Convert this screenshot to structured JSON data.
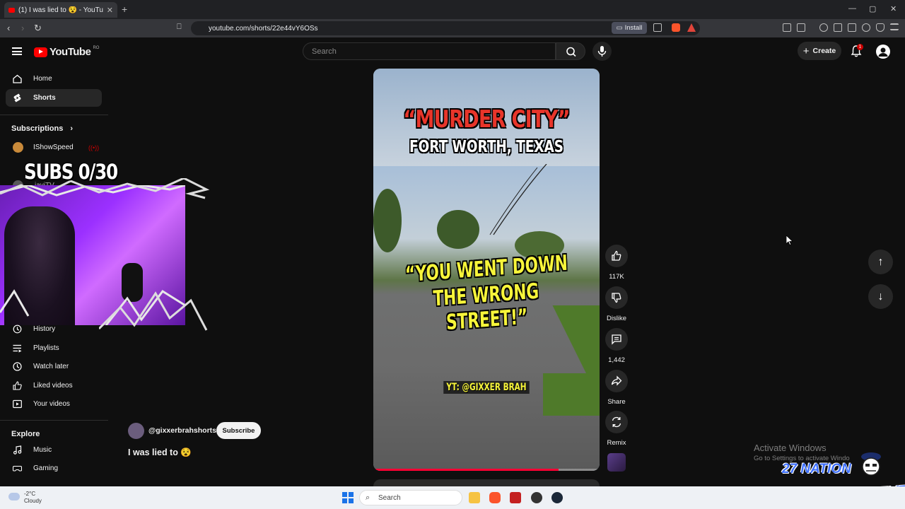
{
  "browser": {
    "tab_title": "(1) I was lied to 😵 - YouTube",
    "url": "youtube.com/shorts/22e44vY6OSs",
    "install_label": "Install"
  },
  "header": {
    "logo_text": "YouTube",
    "country_code": "RO",
    "search_placeholder": "Search",
    "create_label": "Create",
    "notification_count": "1"
  },
  "sidebar": {
    "top_items": [
      {
        "label": "Home",
        "icon": "home-icon"
      },
      {
        "label": "Shorts",
        "icon": "shorts-icon",
        "active": true
      }
    ],
    "subscriptions_heading": "Subscriptions",
    "subscriptions": [
      {
        "label": "IShowSpeed"
      },
      {
        "label": "jayiTV"
      }
    ],
    "you_items": [
      {
        "label": "History",
        "icon": "history-icon"
      },
      {
        "label": "Playlists",
        "icon": "playlists-icon"
      },
      {
        "label": "Watch later",
        "icon": "watch-later-icon"
      },
      {
        "label": "Liked videos",
        "icon": "liked-videos-icon"
      },
      {
        "label": "Your videos",
        "icon": "your-videos-icon"
      }
    ],
    "explore_heading": "Explore",
    "explore_items": [
      {
        "label": "Music",
        "icon": "music-icon"
      },
      {
        "label": "Gaming",
        "icon": "gaming-icon"
      }
    ]
  },
  "overlay": {
    "subs_text": "SUBS 0/30"
  },
  "short": {
    "caption_top_red": "“MURDER CITY”",
    "caption_top_white": "FORT WORTH, TEXAS",
    "caption_mid_1": "“YOU WENT DOWN",
    "caption_mid_2": "THE WRONG STREET!”",
    "caption_credit": "YT: @GIXXER BRAH",
    "progress": 0.82,
    "channel": "@gixxerbrahshorts",
    "subscribe_label": "Subscribe",
    "title": "I was lied to 😵"
  },
  "actions": {
    "likes": "117K",
    "dislike_label": "Dislike",
    "comments": "1,442",
    "share_label": "Share",
    "remix_label": "Remix"
  },
  "watermark": {
    "line1": "Activate Windows",
    "line2": "Go to Settings to activate Windo",
    "logo1_line1": "27 NATION",
    "logo2": "TWENTY7G"
  },
  "taskbar": {
    "temperature": "-2°C",
    "condition": "Cloudy",
    "search_label": "Search"
  },
  "colors": {
    "youtube_red": "#ff0000",
    "caption_red": "#e8352a",
    "caption_yellow": "#f7f53a",
    "accent_purple": "#9b30ff"
  }
}
